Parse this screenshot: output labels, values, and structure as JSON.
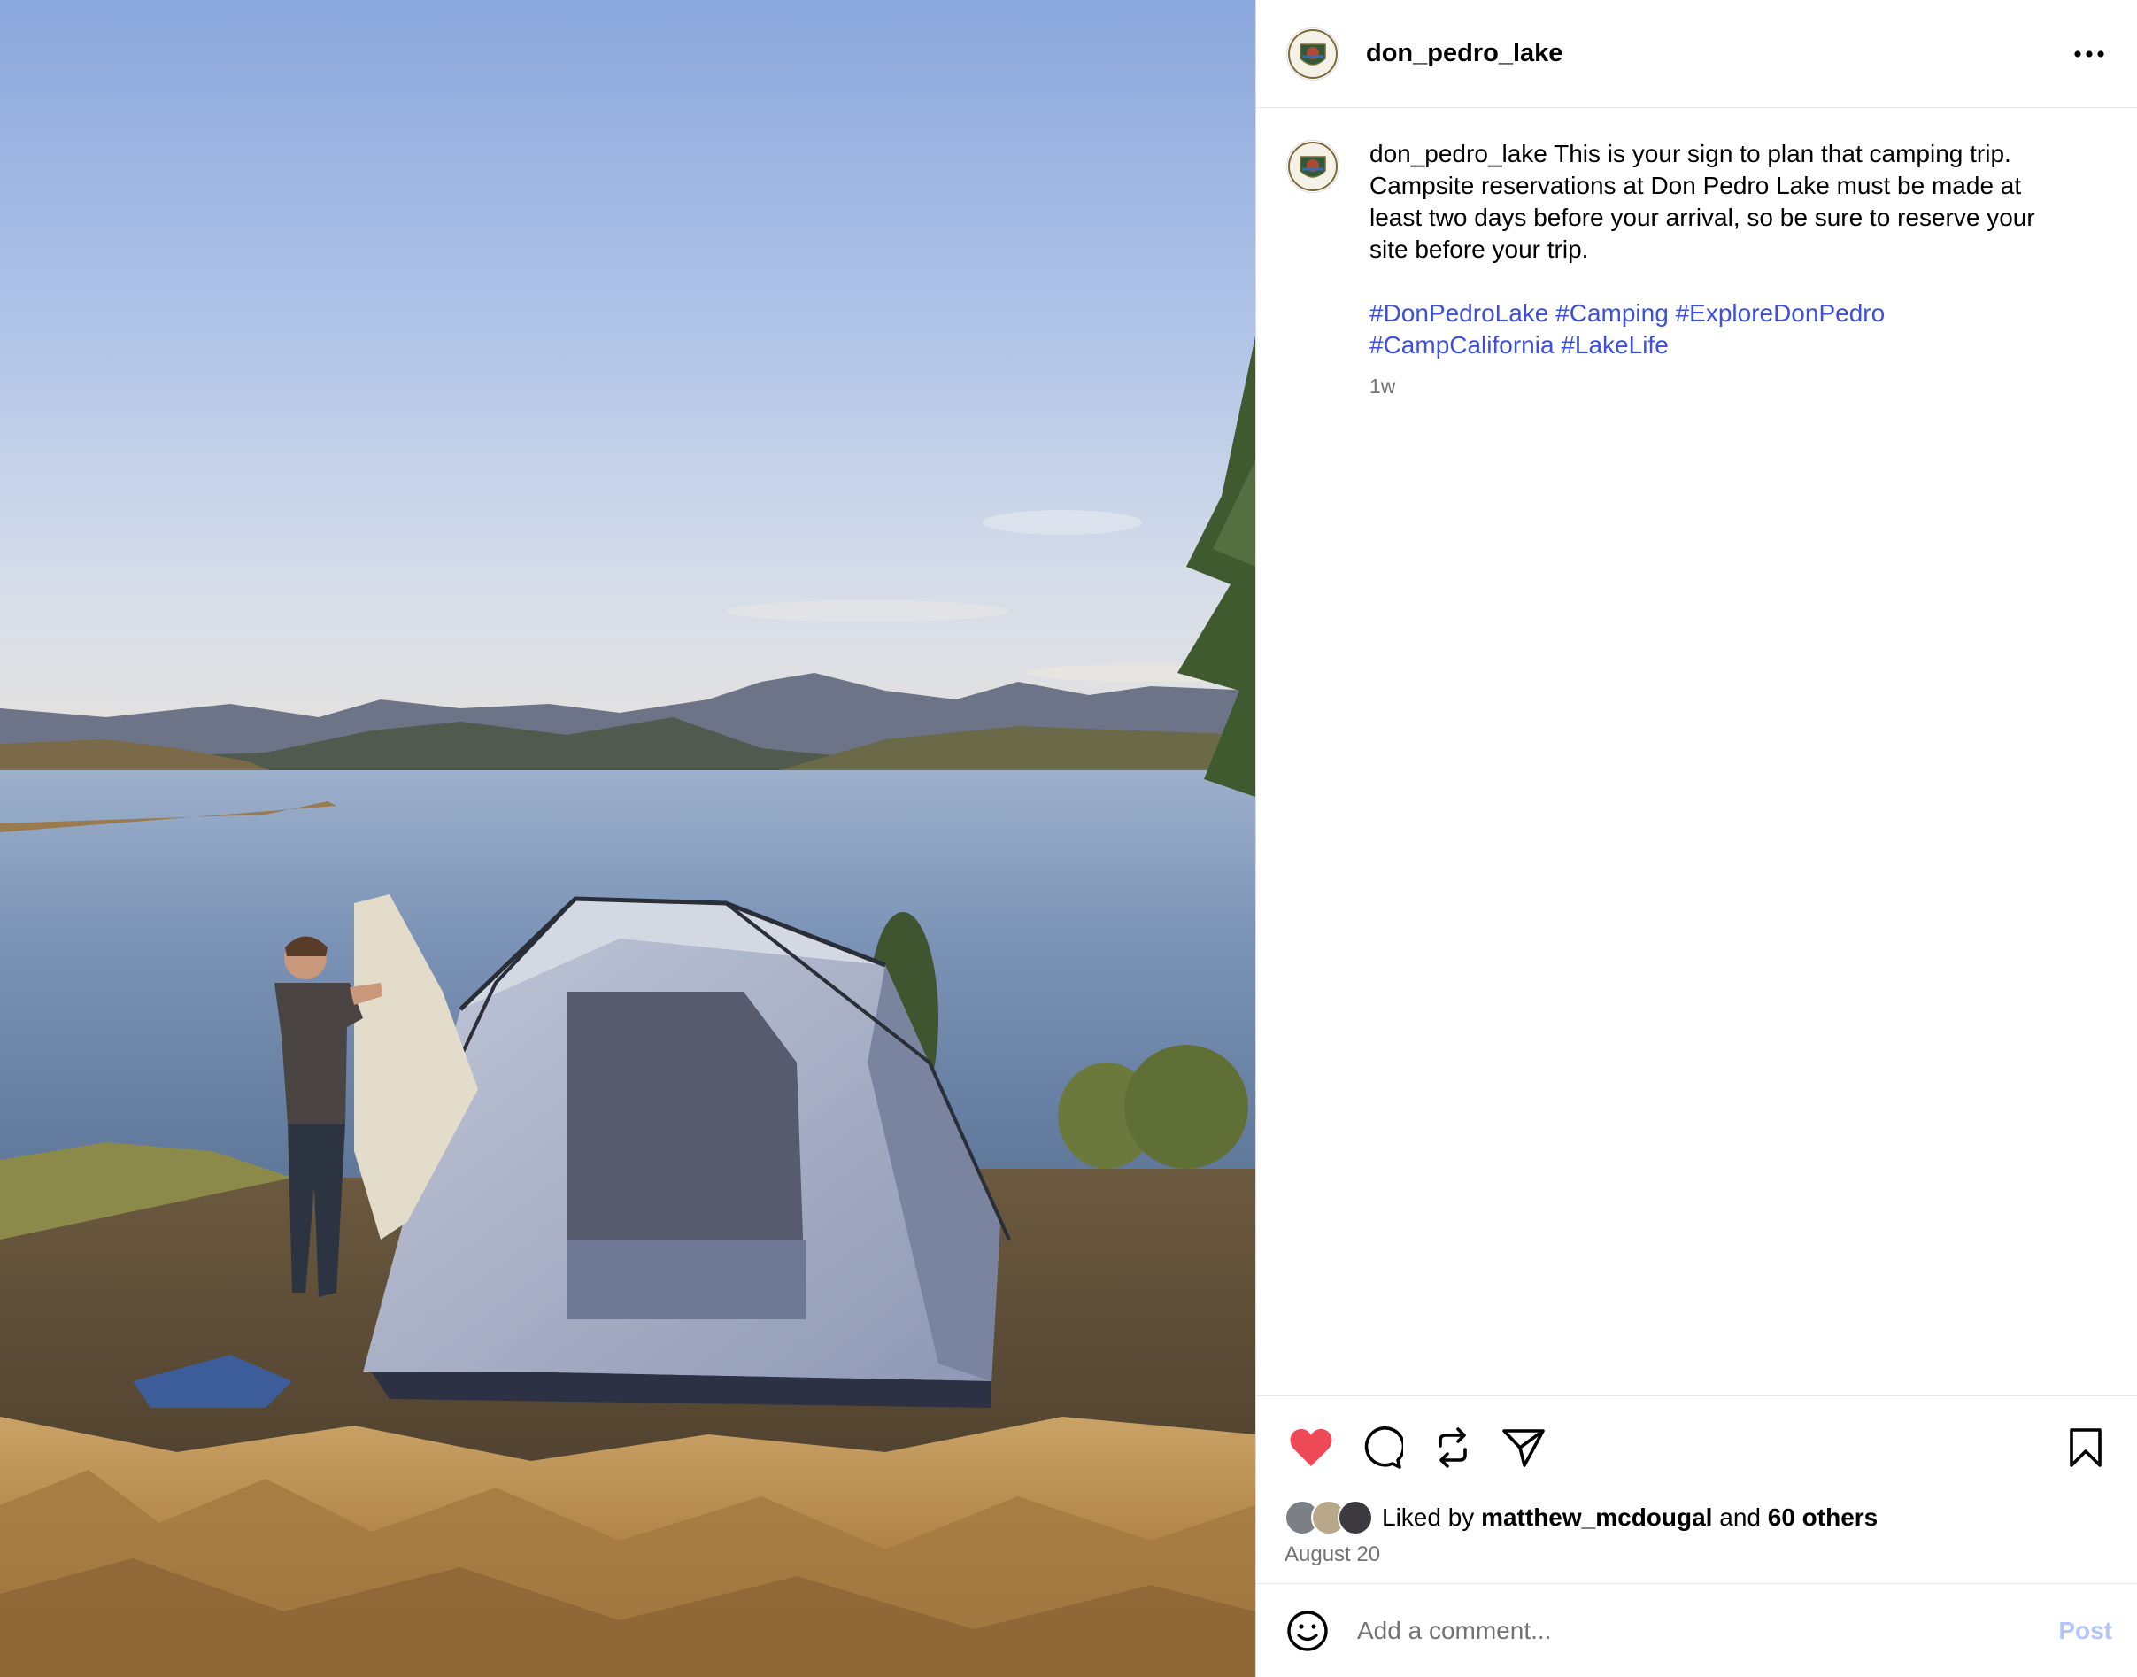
{
  "account": {
    "username": "don_pedro_lake"
  },
  "caption": {
    "username": "don_pedro_lake",
    "text": " This is your sign to plan that camping trip. Campsite reservations at Don Pedro Lake must be made at least two days before your arrival, so be sure to reserve your site before your trip.",
    "hashtags": [
      "#DonPedroLake",
      "#Camping",
      "#ExploreDonPedro",
      "#CampCalifornia",
      "#LakeLife"
    ],
    "age": "1w"
  },
  "actions": {
    "liked": true,
    "like_color": "#ed4956"
  },
  "likes": {
    "prefix": "Liked by",
    "first_user": "matthew_mcdougal",
    "joiner": "and",
    "others": "60 others"
  },
  "date": "August 20",
  "comment": {
    "placeholder": "Add a comment...",
    "post_label": "Post"
  },
  "colors": {
    "hashtag": "#3c4fe0",
    "post_button": "#b3c5ff"
  }
}
